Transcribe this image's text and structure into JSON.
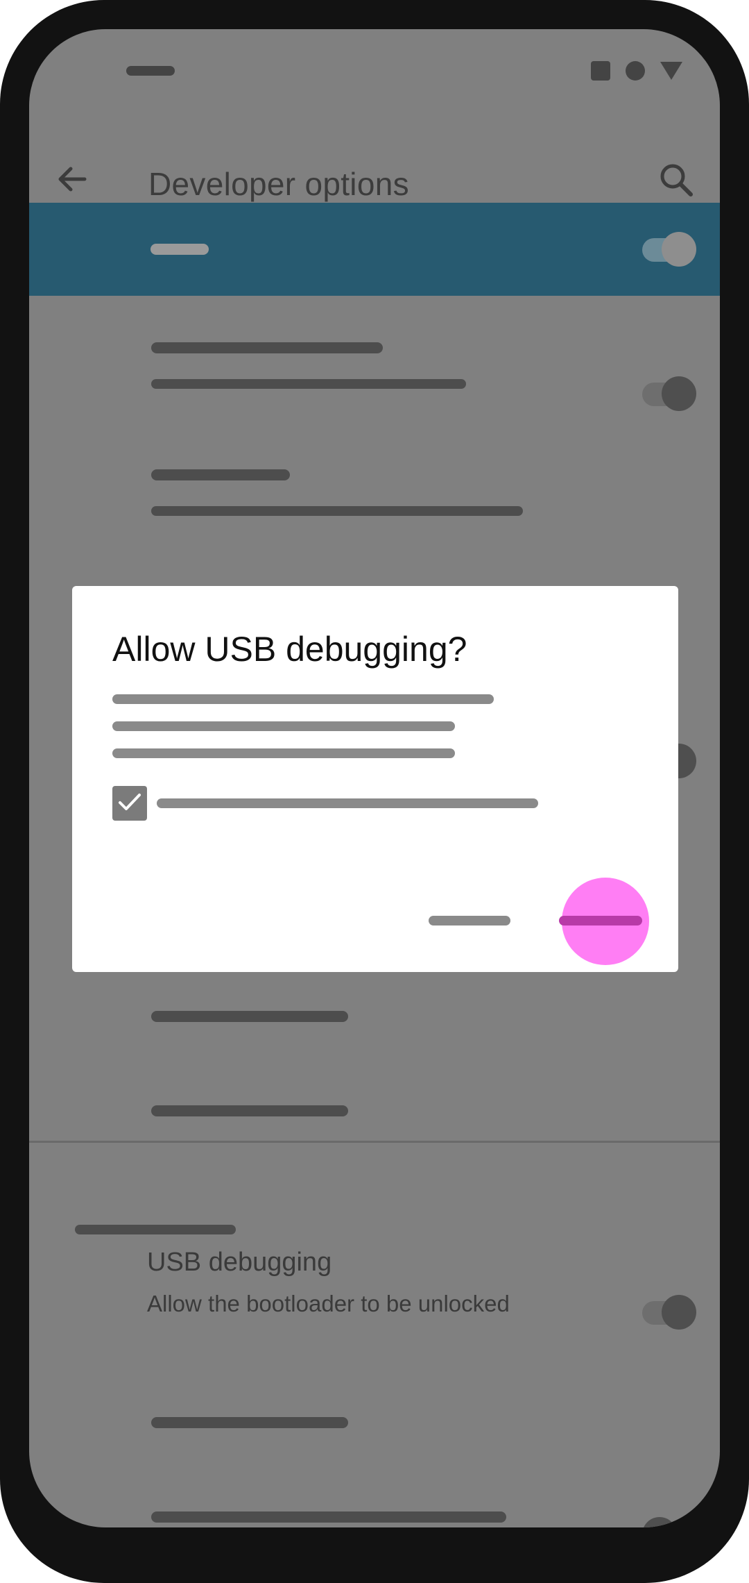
{
  "app_bar": {
    "title": "Developer options",
    "back_icon": "arrow-back-icon",
    "search_icon": "search-icon"
  },
  "status_bar": {
    "icons": [
      "square-icon",
      "circle-icon",
      "triangle-icon"
    ]
  },
  "dialog": {
    "title": "Allow USB debugging?",
    "checkbox_checked": true,
    "checkbox_icon": "check-icon"
  },
  "settings": {
    "usb_debugging": {
      "title": "USB debugging",
      "summary": "Allow the bootloader to be unlocked"
    }
  },
  "colors": {
    "highlight_row": "#275a70",
    "tap_indicator": "#ff7ef4",
    "scrim": "#808080"
  }
}
